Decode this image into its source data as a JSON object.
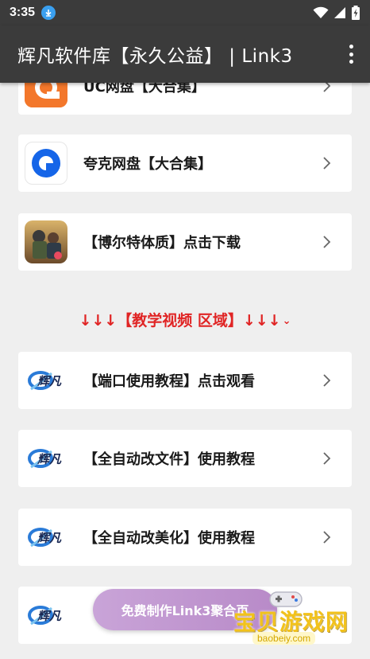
{
  "status_bar": {
    "time": "3:35"
  },
  "app_bar": {
    "title": "辉凡软件库【永久公益】 | Link3"
  },
  "items": [
    {
      "label": "UC网盘【大合集】",
      "icon": "uc-drive-icon"
    },
    {
      "label": "夸克网盘【大合集】",
      "icon": "quark-drive-icon"
    },
    {
      "label": "【博尔特体质】点击下载",
      "icon": "pubg-game-icon"
    }
  ],
  "section": {
    "title": "↓↓↓【教学视频 区域】↓↓↓"
  },
  "tutorials": [
    {
      "label": "【端口使用教程】点击观看",
      "icon": "huifan-logo-icon",
      "logo_text": "辉凡"
    },
    {
      "label": "【全自动改文件】使用教程",
      "icon": "huifan-logo-icon",
      "logo_text": "辉凡"
    },
    {
      "label": "【全自动改美化】使用教程",
      "icon": "huifan-logo-icon",
      "logo_text": "辉凡"
    },
    {
      "label": "",
      "icon": "huifan-logo-icon",
      "logo_text": "辉凡"
    }
  ],
  "fab": {
    "label": "免费制作Link3聚合页"
  },
  "watermark": {
    "text": "宝贝游戏网",
    "url": "baobeiy.com"
  },
  "colors": {
    "bar": "#3b3b3b",
    "accent_red": "#e02424",
    "background": "#efefef"
  }
}
